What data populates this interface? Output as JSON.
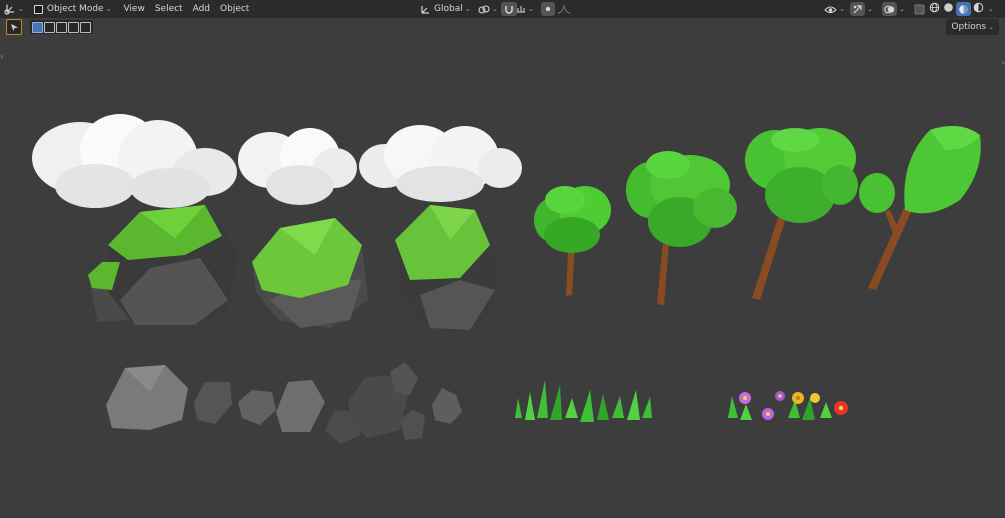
{
  "header": {
    "mode_label": "Object Mode",
    "menus": [
      "View",
      "Select",
      "Add",
      "Object"
    ],
    "transform_orientation": "Global"
  },
  "subheader": {
    "options_label": "Options"
  },
  "icons": {
    "editor_type": "view3d-icon",
    "tool": "select-cursor-icon",
    "visibility": "eye-icon",
    "gizmo": "gizmo-icon",
    "overlay": "overlay-icon",
    "xray": "xray-icon",
    "shading": [
      "wireframe-shading-icon",
      "solid-shading-icon",
      "material-shading-icon",
      "rendered-shading-icon"
    ]
  },
  "colors": {
    "viewport_bg": "#3d3d3d",
    "header_bg": "#2b2b2b",
    "active_accent": "#4772b3"
  },
  "scene_objects": [
    "cloud-large",
    "cloud-medium",
    "cloud-small",
    "rock-grass-large",
    "rock-grass-medium",
    "rock-grass-small",
    "tree-small",
    "tree-medium",
    "tree-large",
    "tree-tall",
    "rock-cluster",
    "grass-patch",
    "flower-patch"
  ]
}
